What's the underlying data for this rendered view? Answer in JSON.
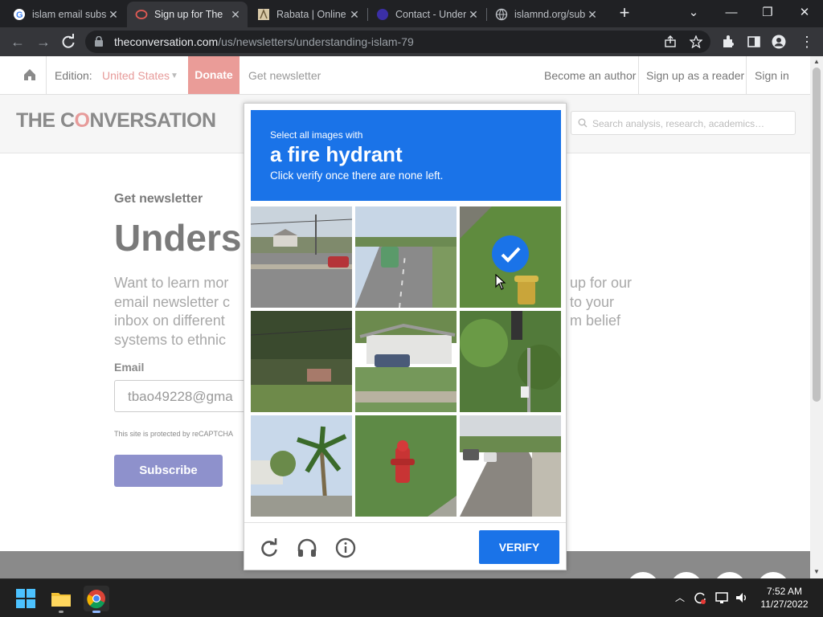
{
  "browser": {
    "tabs": [
      {
        "title": "islam email subs",
        "icon": "google-icon",
        "active": false
      },
      {
        "title": "Sign up for The",
        "icon": "conversation-icon",
        "active": true
      },
      {
        "title": "Rabata | Online",
        "icon": "rabata-icon",
        "active": false
      },
      {
        "title": "Contact - Under",
        "icon": "circle-icon",
        "active": false
      },
      {
        "title": "islamnd.org/sub",
        "icon": "globe-icon",
        "active": false
      }
    ],
    "new_tab": "+",
    "window": {
      "minimize": "—",
      "maximize": "❐",
      "close": "✕",
      "tab_search": "⌄"
    },
    "url_domain": "theconversation.com",
    "url_path": "/us/newsletters/understanding-islam-79"
  },
  "site": {
    "edition_label": "Edition:",
    "edition_value": "United States",
    "donate": "Donate",
    "get_newsletter": "Get newsletter",
    "become_author": "Become an author",
    "sign_up_reader": "Sign up as a reader",
    "sign_in": "Sign in",
    "logo_pre": "THE C",
    "logo_o": "O",
    "logo_post": "NVERSATION",
    "search_placeholder": "Search analysis, research, academics…"
  },
  "content": {
    "kicker": "Get newsletter",
    "headline": "Unders",
    "intro_left": [
      "Want to learn mor",
      "email newsletter c",
      "inbox on different",
      "systems to ethnic"
    ],
    "intro_right": [
      "up for our",
      "to your",
      "m belief",
      ""
    ],
    "email_label": "Email",
    "email_value": "tbao49228@gma",
    "recaptcha_note": "This site is protected by reCAPTCHA",
    "subscribe": "Subscribe"
  },
  "captcha": {
    "line1": "Select all images with",
    "line2": "a fire hydrant",
    "line3": "Click verify once there are none left.",
    "verify": "VERIFY",
    "tiles": [
      {
        "name": "road-intersection",
        "selected": false
      },
      {
        "name": "highway-cars",
        "selected": false
      },
      {
        "name": "yellow-hydrant-grass",
        "selected": true
      },
      {
        "name": "trees-house",
        "selected": false
      },
      {
        "name": "white-house",
        "selected": false
      },
      {
        "name": "traffic-light-trees",
        "selected": false
      },
      {
        "name": "palm-trees",
        "selected": false
      },
      {
        "name": "red-hydrant",
        "selected": false
      },
      {
        "name": "street-cars",
        "selected": false
      }
    ]
  },
  "taskbar": {
    "time": "7:52 AM",
    "date": "11/27/2022"
  },
  "colors": {
    "captcha_blue": "#1a73e8",
    "donate": "#ea9c98",
    "subscribe": "#8e91cc"
  }
}
